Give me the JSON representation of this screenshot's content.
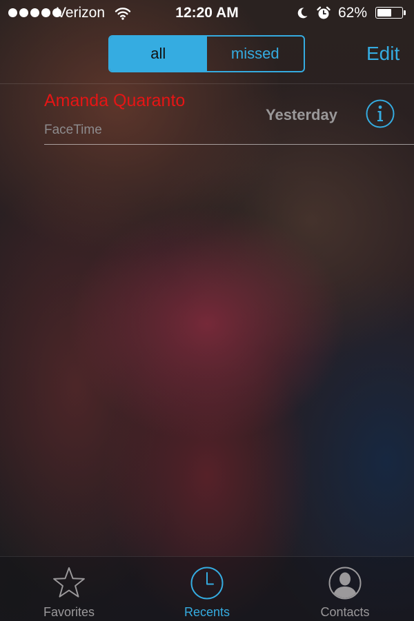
{
  "status_bar": {
    "carrier": "Verizon",
    "time": "12:20 AM",
    "battery_percent": "62%",
    "battery_level": 0.62,
    "signal_bars": 5,
    "icons": [
      "wifi-icon",
      "moon-icon",
      "alarm-icon",
      "battery-icon"
    ]
  },
  "header": {
    "segments": [
      {
        "label": "all",
        "selected": true
      },
      {
        "label": "missed",
        "selected": false
      }
    ],
    "edit_label": "Edit"
  },
  "calls": [
    {
      "name": "Amanda Quaranto",
      "type": "FaceTime",
      "time": "Yesterday",
      "missed": true,
      "info_icon": "info-icon"
    }
  ],
  "tab_bar": {
    "tabs": [
      {
        "label": "Favorites",
        "icon": "star-icon",
        "active": false
      },
      {
        "label": "Recents",
        "icon": "clock-icon",
        "active": true
      },
      {
        "label": "Contacts",
        "icon": "contact-icon",
        "active": false
      }
    ]
  },
  "colors": {
    "accent": "#35ace1",
    "missed_call": "#e61515",
    "secondary_text": "#8d8b8d",
    "inactive_tab": "#9b999b"
  }
}
